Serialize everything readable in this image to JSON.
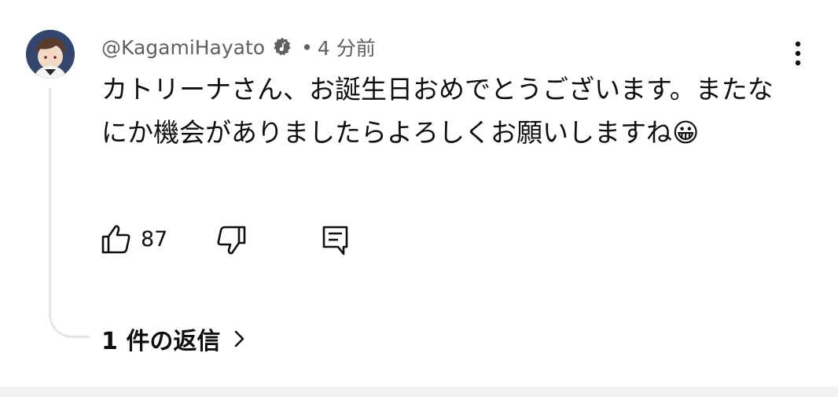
{
  "comment": {
    "author": "@KagamiHayato",
    "separator": "•",
    "time": "4 分前",
    "text": "カトリーナさん、お誕生日おめでとうございます。またなにか機会がありましたらよろしくお願いしますね😀",
    "likes": "87",
    "replies_label": "1 件の返信"
  },
  "icons": {
    "avatar": "avatar-image",
    "verified": "music-note-badge-icon",
    "more": "more-vertical-icon",
    "like": "thumbs-up-icon",
    "dislike": "thumbs-down-icon",
    "reply": "comment-reply-icon",
    "chevron": "chevron-right-icon"
  },
  "colors": {
    "text_primary": "#0f0f0f",
    "text_secondary": "#606060",
    "thread_line": "#e5e5e5",
    "bottom_bar": "#f2f2f2"
  }
}
